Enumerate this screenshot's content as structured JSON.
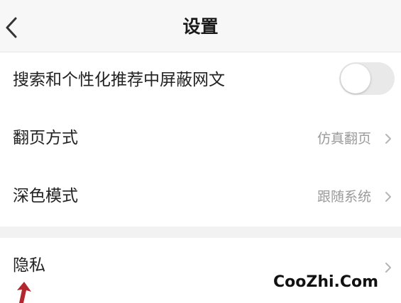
{
  "header": {
    "title": "设置",
    "back_icon": "chevron-left-icon"
  },
  "settings": {
    "hide_web_novels": {
      "label": "搜索和个性化推荐中屏蔽网文",
      "enabled": false
    },
    "page_turn": {
      "label": "翻页方式",
      "value": "仿真翻页"
    },
    "dark_mode": {
      "label": "深色模式",
      "value": "跟随系统"
    },
    "privacy": {
      "label": "隐私"
    }
  },
  "watermark": "CooZhi.Com",
  "colors": {
    "header_bg": "#f7f7f7",
    "section_gap": "#f2f2f2",
    "secondary_text": "#9a9a9a",
    "toggle_off": "#e9e9e9",
    "annotation_arrow": "#b3262d"
  }
}
